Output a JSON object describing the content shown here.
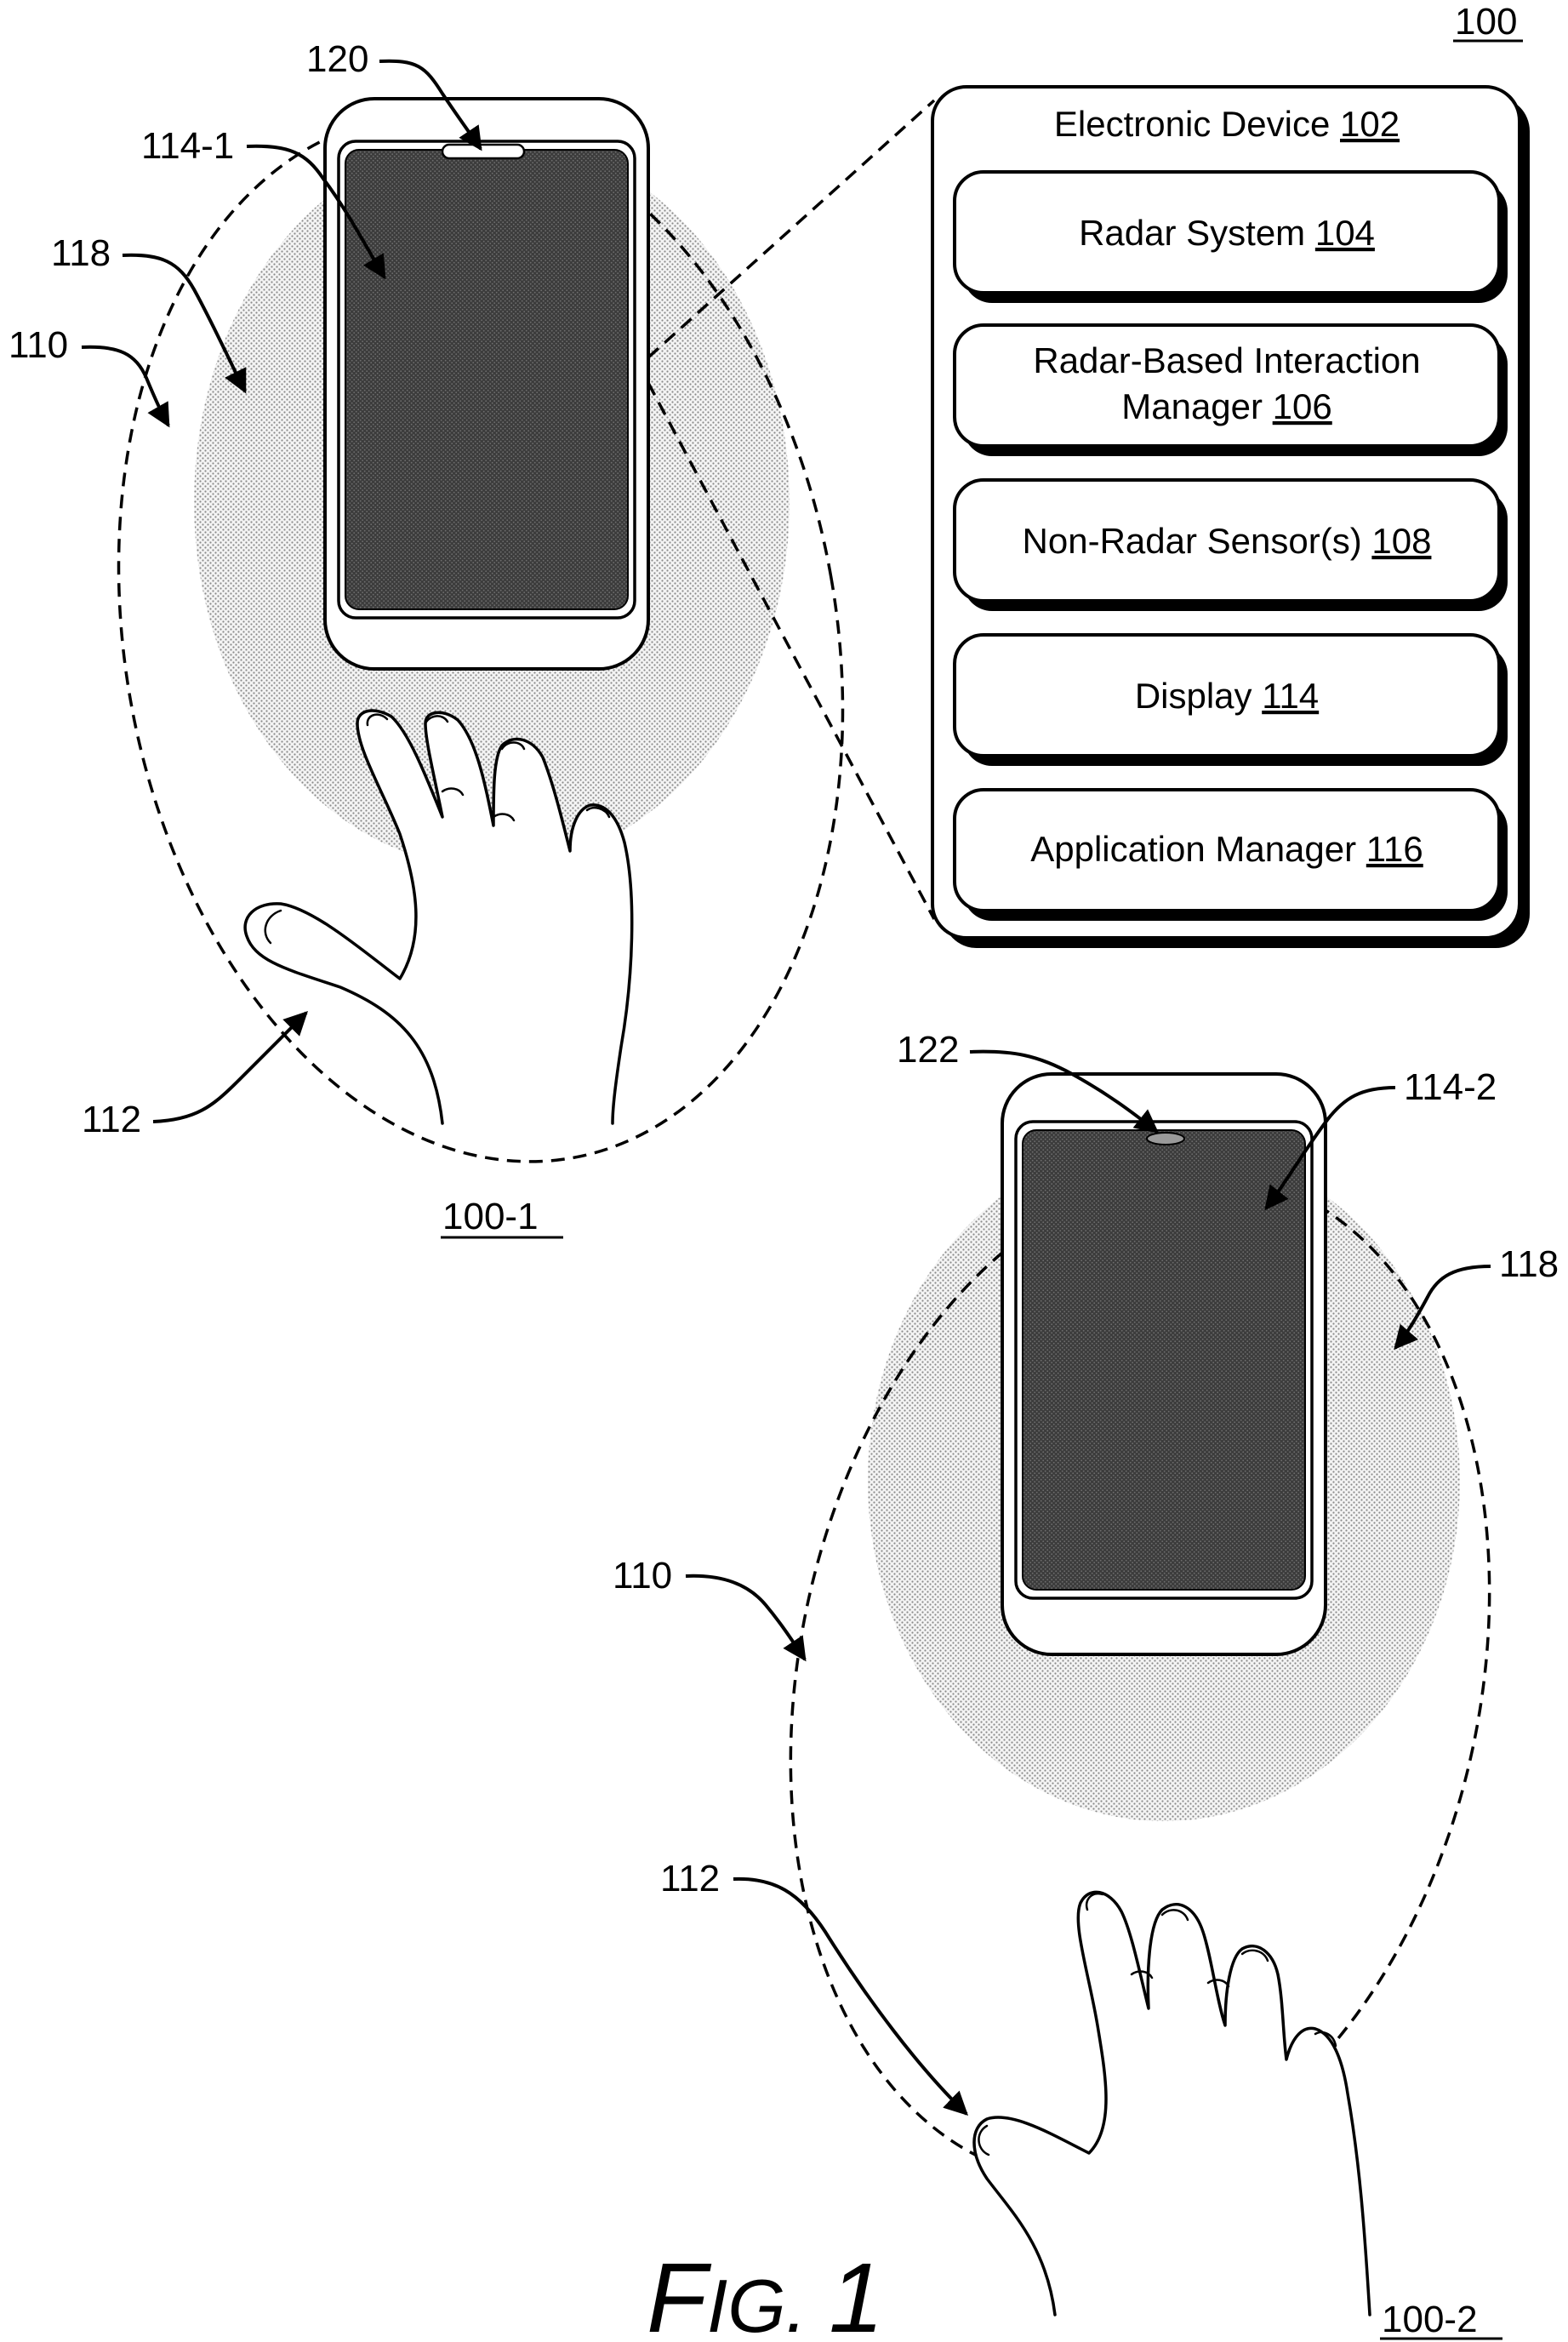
{
  "figure": {
    "ref_main": "100",
    "caption_prefix": "F",
    "caption_small": "IG.",
    "caption_number": "1"
  },
  "device_panel": {
    "title_text": "Electronic Device ",
    "title_ref": "102",
    "components": [
      {
        "name": "Radar System ",
        "ref": "104"
      },
      {
        "line1": "Radar-Based Interaction",
        "line2": "Manager ",
        "ref": "106"
      },
      {
        "name": "Non-Radar Sensor(s) ",
        "ref": "108"
      },
      {
        "name": "Display ",
        "ref": "114"
      },
      {
        "name": "Application Manager ",
        "ref": "116"
      }
    ]
  },
  "view_1": {
    "ref": "100-1",
    "labels": {
      "camera": "120",
      "display": "114-1",
      "radar_field": "118",
      "boundary": "110",
      "user": "112"
    }
  },
  "view_2": {
    "ref": "100-2",
    "labels": {
      "camera": "122",
      "display": "114-2",
      "radar_field": "118",
      "boundary": "110",
      "user": "112"
    }
  }
}
